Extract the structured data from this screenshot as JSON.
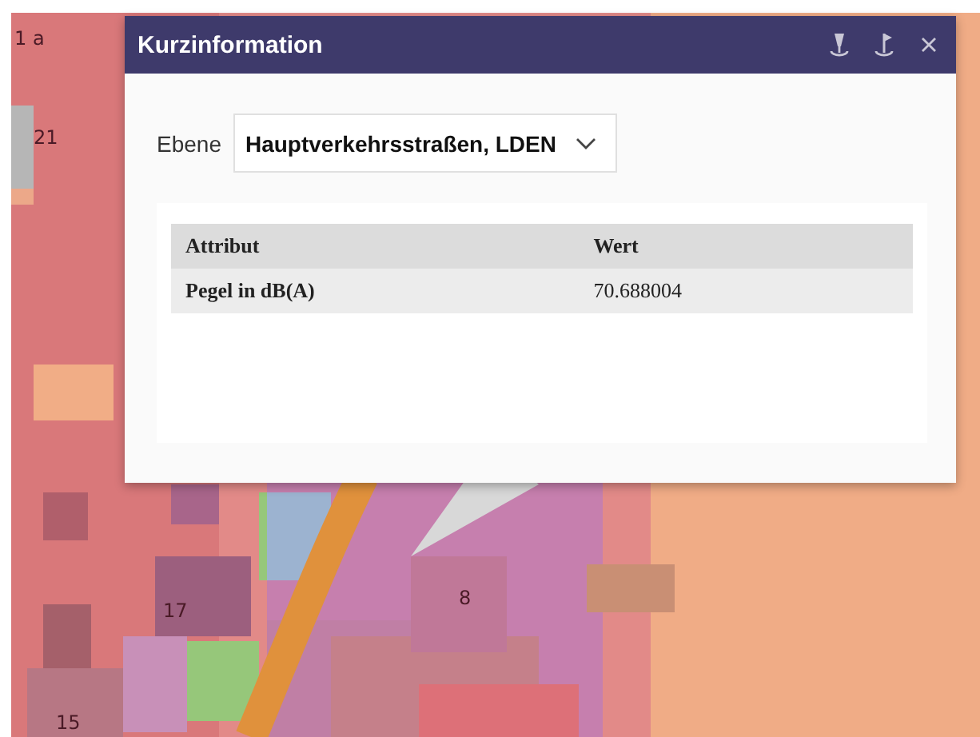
{
  "map": {
    "labels": [
      "1 a",
      "21",
      "17",
      "8",
      "15"
    ]
  },
  "popup": {
    "title": "Kurzinformation",
    "layer": {
      "label": "Ebene",
      "value": "Hauptverkehrsstraßen, LDEN"
    },
    "table": {
      "columns": [
        "Attribut",
        "Wert"
      ],
      "rows": [
        [
          "Pegel in dB(A)",
          "70.688004"
        ]
      ]
    }
  }
}
